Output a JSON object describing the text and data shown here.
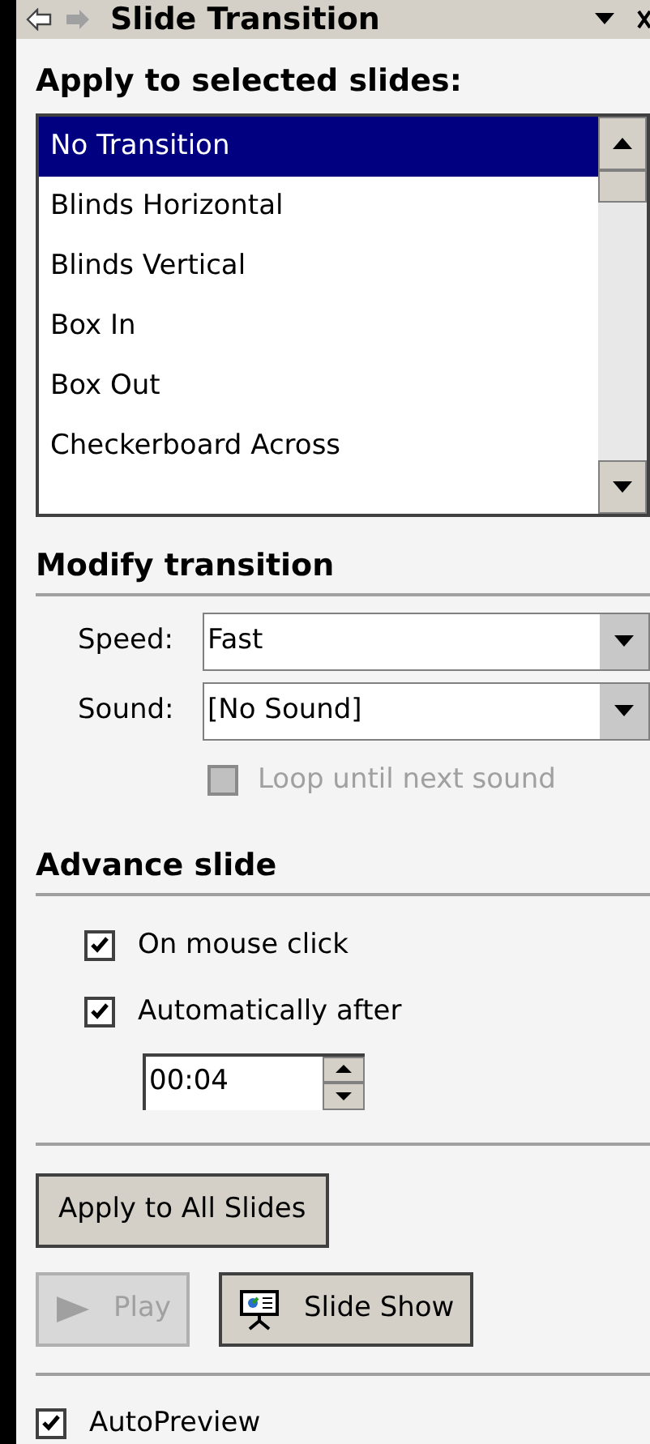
{
  "title": "Slide Transition",
  "apply_section": {
    "heading": "Apply to selected slides:",
    "items": [
      {
        "label": "No Transition",
        "selected": true
      },
      {
        "label": "Blinds Horizontal",
        "selected": false
      },
      {
        "label": "Blinds Vertical",
        "selected": false
      },
      {
        "label": "Box In",
        "selected": false
      },
      {
        "label": "Box Out",
        "selected": false
      },
      {
        "label": "Checkerboard Across",
        "selected": false
      }
    ]
  },
  "modify_section": {
    "heading": "Modify transition",
    "fields": [
      {
        "label": "Speed:",
        "value": "Fast"
      },
      {
        "label": "Sound:",
        "value": "[No Sound]"
      }
    ],
    "loop": {
      "label": "Loop until next sound",
      "checked": false,
      "disabled": true
    }
  },
  "advance_section": {
    "heading": "Advance slide",
    "options": [
      {
        "label": "On mouse click",
        "checked": true
      },
      {
        "label": "Automatically after",
        "checked": true
      }
    ],
    "time": "00:04"
  },
  "apply_all_button": {
    "label": "Apply to All Slides"
  },
  "buttons": [
    {
      "kind": "play",
      "label": "Play",
      "disabled": true
    },
    {
      "kind": "slideshow",
      "label": "Slide Show",
      "disabled": false
    }
  ],
  "autopreview": {
    "label": "AutoPreview",
    "checked": true
  }
}
